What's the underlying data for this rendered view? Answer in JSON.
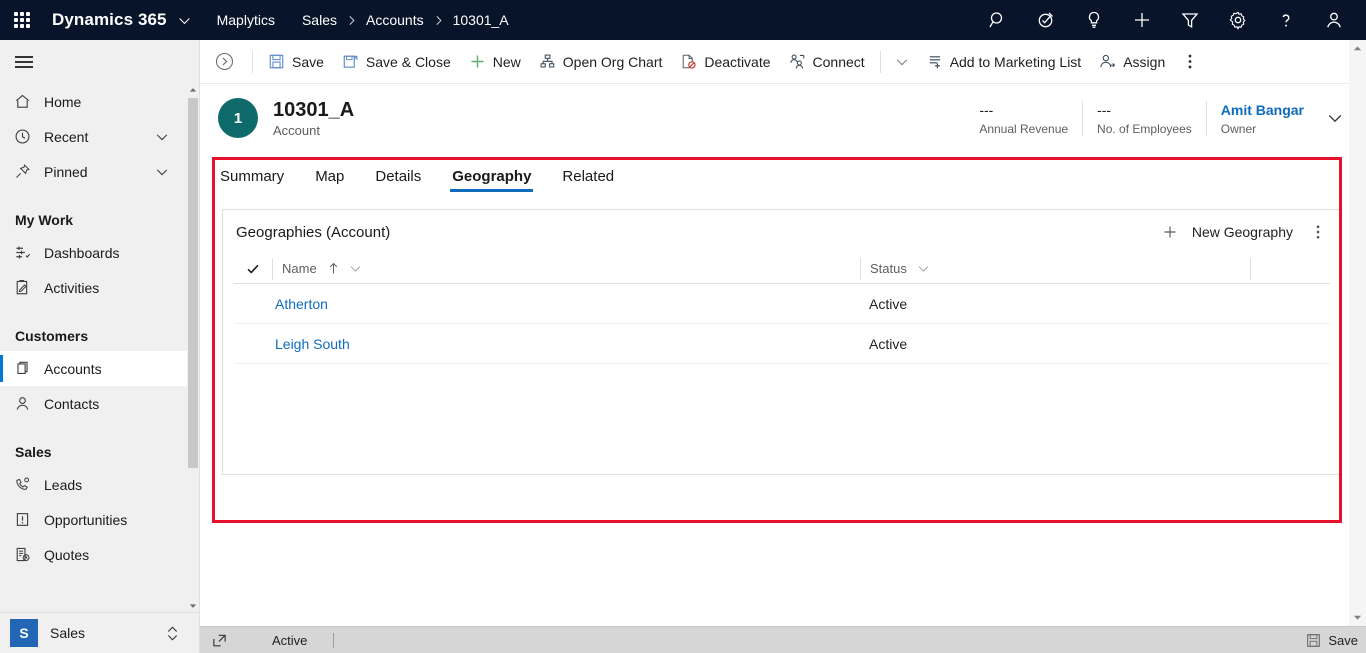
{
  "topbar": {
    "waffle_label": "app-launcher",
    "brand": "Dynamics 365",
    "app": "Maplytics",
    "breadcrumb": [
      "Sales",
      "Accounts",
      "10301_A"
    ],
    "icons": [
      "search-icon",
      "assistant-icon",
      "insights-icon",
      "quick-create-icon",
      "filter-icon",
      "settings-icon",
      "help-icon",
      "user-avatar-icon"
    ]
  },
  "sidebar": {
    "hamburger_label": "Expand/Collapse navigation",
    "items": [
      {
        "label": "Home",
        "icon": "home-icon",
        "type": "item"
      },
      {
        "label": "Recent",
        "icon": "clock-icon",
        "type": "expandable"
      },
      {
        "label": "Pinned",
        "icon": "pin-icon",
        "type": "expandable"
      },
      {
        "label": "My Work",
        "type": "group"
      },
      {
        "label": "Dashboards",
        "icon": "dashboard-icon",
        "type": "item"
      },
      {
        "label": "Activities",
        "icon": "activities-icon",
        "type": "item"
      },
      {
        "label": "Customers",
        "type": "group"
      },
      {
        "label": "Accounts",
        "icon": "accounts-icon",
        "type": "item",
        "selected": true
      },
      {
        "label": "Contacts",
        "icon": "contact-icon",
        "type": "item"
      },
      {
        "label": "Sales",
        "type": "group"
      },
      {
        "label": "Leads",
        "icon": "leads-icon",
        "type": "item"
      },
      {
        "label": "Opportunities",
        "icon": "opportunities-icon",
        "type": "item"
      },
      {
        "label": "Quotes",
        "icon": "quotes-icon",
        "type": "item"
      }
    ],
    "app_switcher": {
      "tile": "S",
      "name": "Sales"
    }
  },
  "commandbar": {
    "back_label": "navigate-forward",
    "buttons": [
      {
        "label": "Save",
        "icon": "save-icon"
      },
      {
        "label": "Save & Close",
        "icon": "save-close-icon"
      },
      {
        "label": "New",
        "icon": "plus-icon"
      },
      {
        "label": "Open Org Chart",
        "icon": "org-chart-icon"
      },
      {
        "label": "Deactivate",
        "icon": "deactivate-icon"
      },
      {
        "label": "Connect",
        "icon": "connect-icon"
      },
      {
        "label": "Add to Marketing List",
        "icon": "marketing-list-icon"
      },
      {
        "label": "Assign",
        "icon": "assign-icon"
      }
    ],
    "overflow_label": "more-commands"
  },
  "record": {
    "avatar_initial": "1",
    "title": "10301_A",
    "subtitle": "Account",
    "fields": [
      {
        "value": "---",
        "label": "Annual Revenue"
      },
      {
        "value": "---",
        "label": "No. of Employees"
      },
      {
        "value": "Amit Bangar",
        "label": "Owner",
        "link": true
      }
    ],
    "expand_label": "expand-header"
  },
  "tabs": [
    {
      "label": "Summary",
      "active": false
    },
    {
      "label": "Map",
      "active": false
    },
    {
      "label": "Details",
      "active": false
    },
    {
      "label": "Geography",
      "active": true
    },
    {
      "label": "Related",
      "active": false
    }
  ],
  "subgrid": {
    "title": "Geographies (Account)",
    "new_button": "New Geography",
    "overflow_label": "more-subgrid-commands",
    "columns": [
      {
        "label": "Name",
        "sort": "ascending"
      },
      {
        "label": "Status",
        "sort": null
      }
    ],
    "rows": [
      {
        "name": "Atherton",
        "status": "Active"
      },
      {
        "name": "Leigh South",
        "status": "Active"
      }
    ]
  },
  "statusbar": {
    "popout_label": "open-in-new-window",
    "state": "Active",
    "save_label": "Save"
  },
  "colors": {
    "nav_bg": "#071429",
    "accent": "#0f6cbd",
    "link": "#0f6cbd",
    "avatar": "#0f6b6b",
    "annotation": "#e8112d",
    "app_tile": "#2266b5"
  }
}
